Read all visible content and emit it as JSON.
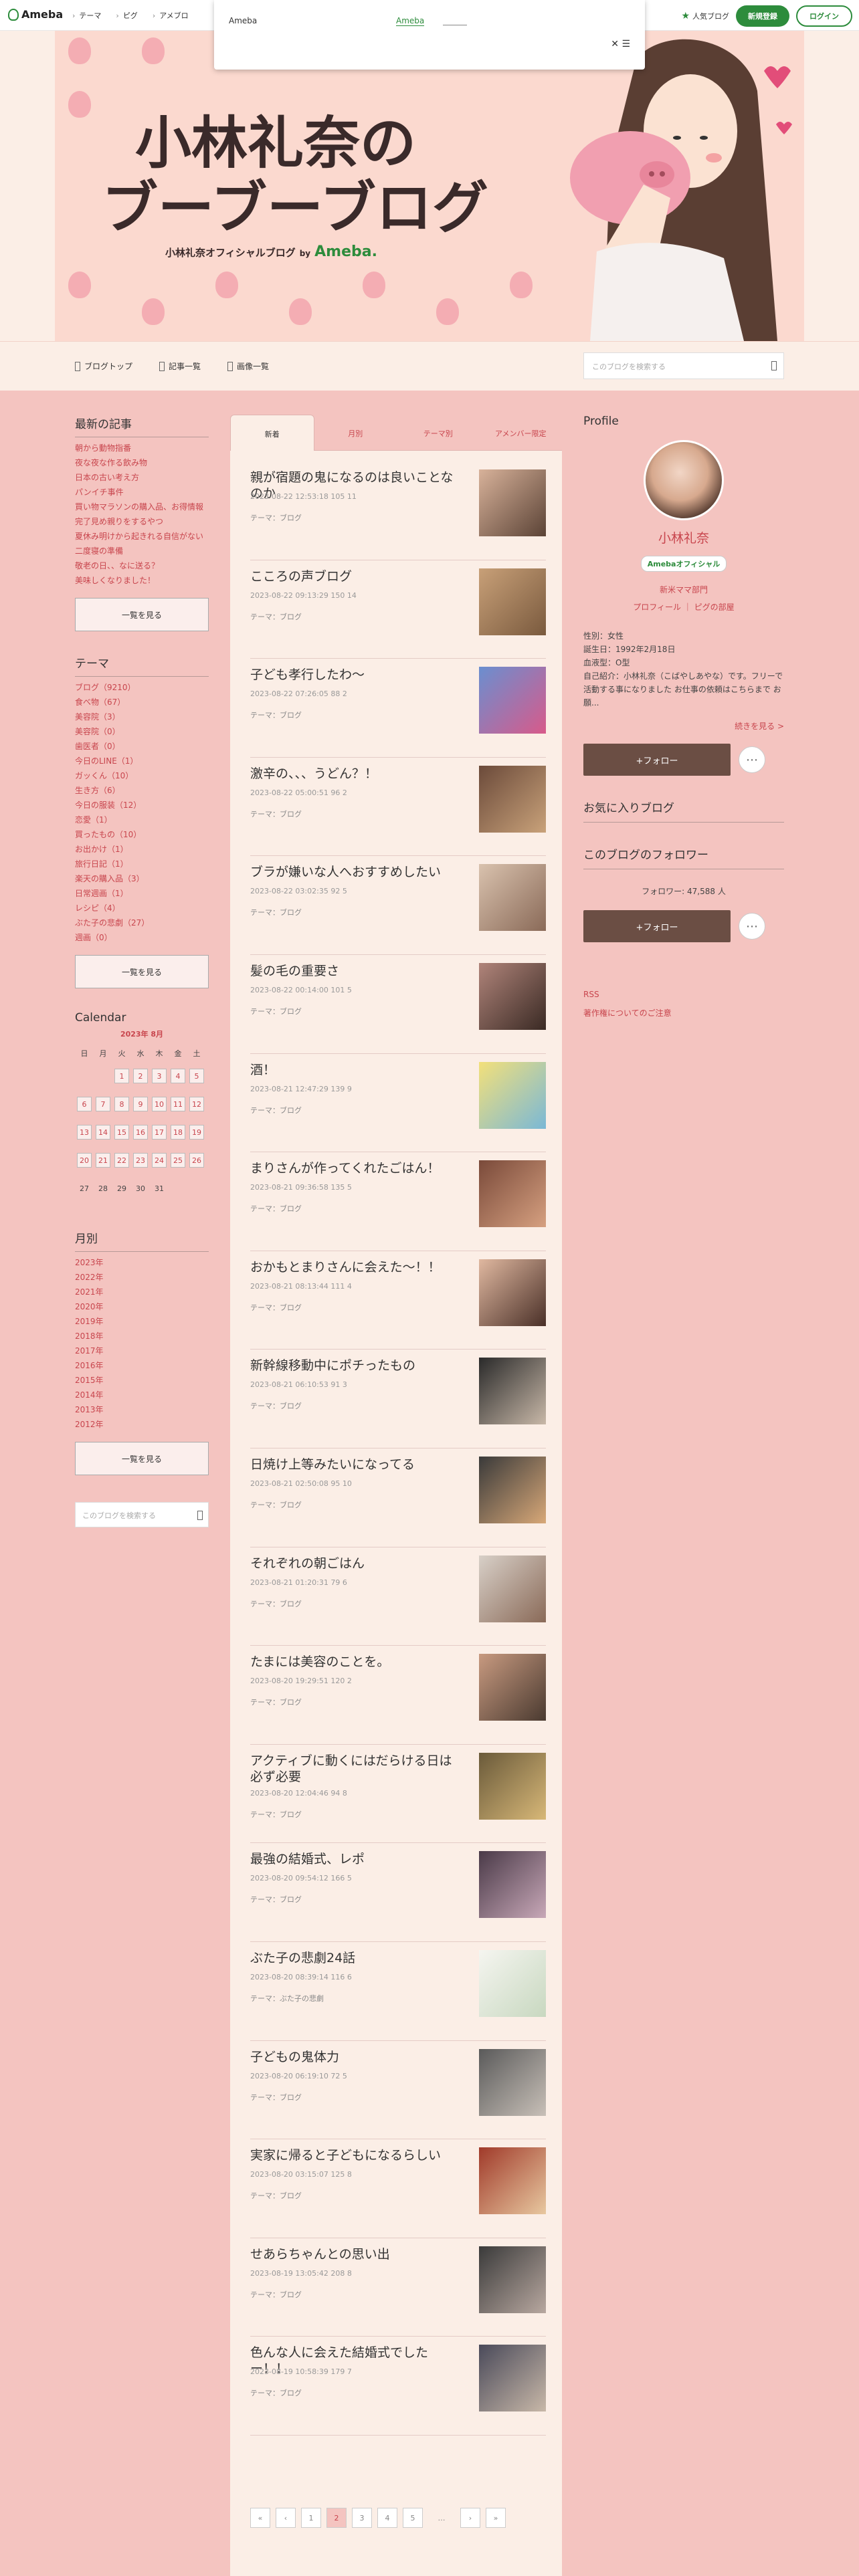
{
  "global_header": {
    "logo": "Ameba",
    "nav": [
      "テーマ",
      "ピグ",
      "アメブロ"
    ],
    "popular_label": "人気ブログ",
    "register_label": "新規登録",
    "login_label": "ログイン"
  },
  "popup": {
    "title": "Ameba",
    "link": "Ameba",
    "close": "✕ ☰"
  },
  "banner": {
    "title_line1": "小林礼奈の",
    "title_line2": "ブーブーブログ",
    "subtitle": "小林礼奈オフィシャルブログ",
    "by": "by",
    "brand": "Ameba."
  },
  "blog_nav": {
    "items": [
      "ブログトップ",
      "記事一覧",
      "画像一覧"
    ],
    "search_placeholder": "このブログを検索する"
  },
  "left": {
    "recent_heading": "最新の記事",
    "recent": [
      "朝から動物指番",
      "夜な夜な作る飲み物",
      "日本の古い考え方",
      "パンイチ事件",
      "買い物マラソンの購入品、お得情報",
      "完了見め親りをするやつ",
      "夏休み明けから起きれる自信がない",
      "二度寝の準備",
      "敬老の日、、なに送る？",
      "美味しくなりました！"
    ],
    "more1": "一覧を見る",
    "theme_heading": "テーマ",
    "themes": [
      "ブログ（9210）",
      "食べ物（67）",
      "美容院（3）",
      "美容院（0）",
      "歯医者（0）",
      "今日のLINE（1）",
      "ガッくん（10）",
      "生き方（6）",
      "今日の服装（12）",
      "恋愛（1）",
      "買ったもの（10）",
      "お出かけ（1）",
      "旅行日記（1）",
      "楽天の購入品（3）",
      "日常週画（1）",
      "レシピ（4）",
      "ぶた子の悲劇（27）",
      "週画（0）"
    ],
    "more2": "一覧を見る",
    "calendar_heading": "Calendar",
    "calendar_month": "2023年 8月",
    "weekdays": [
      "日",
      "月",
      "火",
      "水",
      "木",
      "金",
      "土"
    ],
    "weeks": [
      [
        "",
        "",
        "1",
        "2",
        "3",
        "4",
        "5"
      ],
      [
        "6",
        "7",
        "8",
        "9",
        "10",
        "11",
        "12"
      ],
      [
        "13",
        "14",
        "15",
        "16",
        "17",
        "18",
        "19"
      ],
      [
        "20",
        "21",
        "22",
        "23",
        "24",
        "25",
        "26"
      ],
      [
        "27",
        "28",
        "29",
        "30",
        "31",
        "",
        ""
      ]
    ],
    "monthly_heading": "月別",
    "years": [
      "2023年",
      "2022年",
      "2021年",
      "2020年",
      "2019年",
      "2018年",
      "2017年",
      "2016年",
      "2015年",
      "2014年",
      "2013年",
      "2012年"
    ],
    "more3": "一覧を見る",
    "search_placeholder": "このブログを検索する"
  },
  "tabs": [
    "新着",
    "月別",
    "テーマ別",
    "アメンバー限定"
  ],
  "entries": [
    {
      "title": "親が宿題の鬼になるのは良いことなのか",
      "meta": "2023-08-22 12:53:18 105 11",
      "theme": "テーマ：ブログ"
    },
    {
      "title": "こころの声ブログ",
      "meta": "2023-08-22 09:13:29 150 14",
      "theme": "テーマ：ブログ"
    },
    {
      "title": "子ども孝行したわ〜",
      "meta": "2023-08-22 07:26:05 88 2",
      "theme": "テーマ：ブログ"
    },
    {
      "title": "激辛の、、、うどん？！",
      "meta": "2023-08-22 05:00:51 96 2",
      "theme": "テーマ：ブログ"
    },
    {
      "title": "ブラが嫌いな人へおすすめしたい",
      "meta": "2023-08-22 03:02:35 92 5",
      "theme": "テーマ：ブログ"
    },
    {
      "title": "髪の毛の重要さ",
      "meta": "2023-08-22 00:14:00 101 5",
      "theme": "テーマ：ブログ"
    },
    {
      "title": "酒！",
      "meta": "2023-08-21 12:47:29 139 9",
      "theme": "テーマ：ブログ"
    },
    {
      "title": "まりさんが作ってくれたごはん！",
      "meta": "2023-08-21 09:36:58 135 5",
      "theme": "テーマ：ブログ"
    },
    {
      "title": "おかもとまりさんに会えた〜！！",
      "meta": "2023-08-21 08:13:44 111 4",
      "theme": "テーマ：ブログ"
    },
    {
      "title": "新幹線移動中にポチったもの",
      "meta": "2023-08-21 06:10:53 91 3",
      "theme": "テーマ：ブログ"
    },
    {
      "title": "日焼け上等みたいになってる",
      "meta": "2023-08-21 02:50:08 95 10",
      "theme": "テーマ：ブログ"
    },
    {
      "title": "それぞれの朝ごはん",
      "meta": "2023-08-21 01:20:31 79 6",
      "theme": "テーマ：ブログ"
    },
    {
      "title": "たまには美容のことを。",
      "meta": "2023-08-20 19:29:51 120 2",
      "theme": "テーマ：ブログ"
    },
    {
      "title": "アクティブに動くにはだらける日は必ず必要",
      "meta": "2023-08-20 12:04:46 94 8",
      "theme": "テーマ：ブログ"
    },
    {
      "title": "最強の結婚式、レポ",
      "meta": "2023-08-20 09:54:12 166 5",
      "theme": "テーマ：ブログ"
    },
    {
      "title": "ぶた子の悲劇24話",
      "meta": "2023-08-20 08:39:14 116 6",
      "theme": "テーマ：ぶた子の悲劇"
    },
    {
      "title": "子どもの鬼体力",
      "meta": "2023-08-20 06:19:10 72 5",
      "theme": "テーマ：ブログ"
    },
    {
      "title": "実家に帰ると子どもになるらしい",
      "meta": "2023-08-20 03:15:07 125 8",
      "theme": "テーマ：ブログ"
    },
    {
      "title": "せあらちゃんとの思い出",
      "meta": "2023-08-19 13:05:42 208 8",
      "theme": "テーマ：ブログ"
    },
    {
      "title": "色んな人に会えた結婚式でしたー！！",
      "meta": "2023-08-19 10:58:39 179 7",
      "theme": "テーマ：ブログ"
    }
  ],
  "pager": [
    "«",
    "‹",
    "1",
    "2",
    "3",
    "4",
    "5",
    "…",
    "›",
    "»"
  ],
  "right": {
    "profile_heading": "Profile",
    "name": "小林礼奈",
    "badge": "Amebaオフィシャル",
    "link1": "新米ママ部門",
    "link2": "プロフィール ｜ ピグの部屋",
    "info": [
      "性別：女性",
      "誕生日：1992年2月18日",
      "血液型：O型",
      "自己紹介：小林礼奈（こばやしあやな）です。フリーで活動する事になりました お仕事の依頼はこちらまで お願..."
    ],
    "next": "続きを見る >",
    "follow_label": "+フォロー",
    "favorite_heading": "お気に入りブログ",
    "follower_heading": "このブログのフォロワー",
    "follower_count": "フォロワー: 47,588 人",
    "rss": "RSS",
    "copyright": "著作権についてのご注意"
  }
}
